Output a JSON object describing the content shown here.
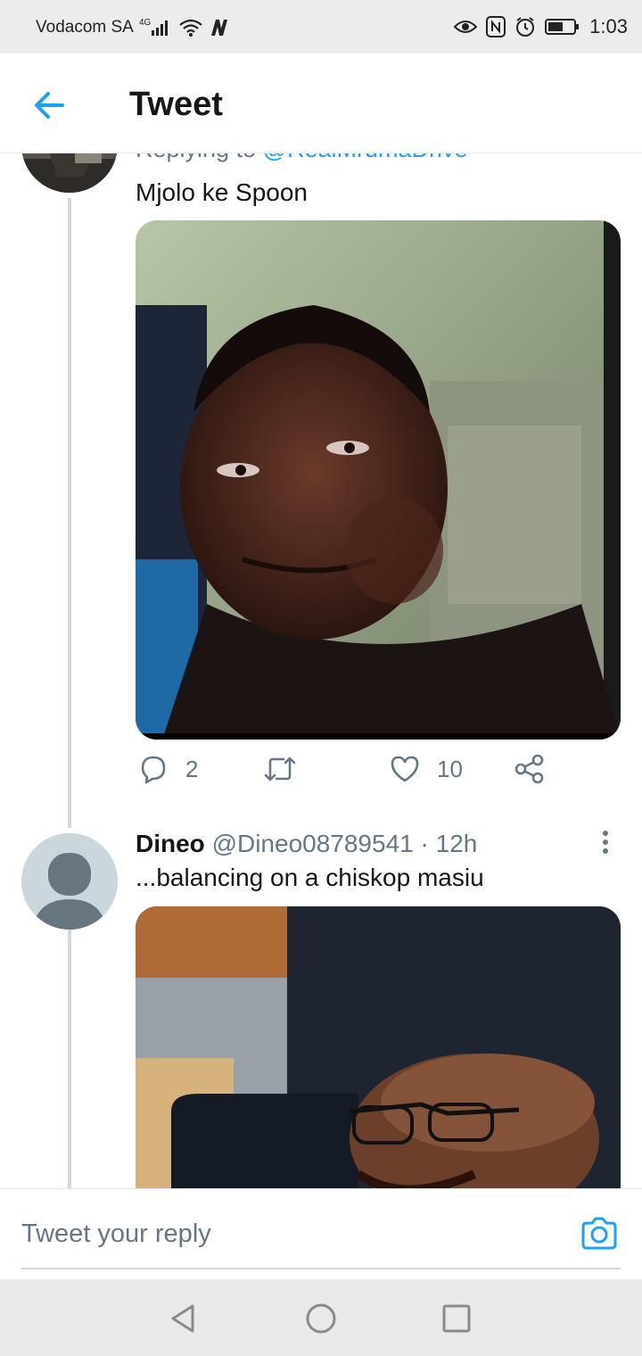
{
  "status_bar": {
    "carrier": "Vodacom SA",
    "network": "4G",
    "time": "1:03",
    "icons": [
      "signal-icon",
      "wifi-icon",
      "n-app-icon",
      "eye-comfort-icon",
      "nfc-icon",
      "alarm-icon",
      "battery-icon"
    ]
  },
  "header": {
    "title": "Tweet",
    "back_icon": "back-arrow-icon"
  },
  "thread": {
    "tweet1": {
      "replying_to_label": "Replying to",
      "replying_to_handle": "@RealMrumaDrive",
      "text": "Mjolo ke Spoon",
      "reply_count": "2",
      "retweet_count": "",
      "like_count": "10"
    },
    "tweet2": {
      "name": "Dineo",
      "handle": "@Dineo08789541",
      "separator": "·",
      "time": "12h",
      "text": "...balancing on a chiskop masiu"
    }
  },
  "reply_bar": {
    "placeholder": "Tweet your reply",
    "camera_icon": "camera-icon"
  },
  "nav_bar": {
    "icons": [
      "nav-back-icon",
      "nav-home-icon",
      "nav-recents-icon"
    ]
  },
  "colors": {
    "accent": "#1da1f2",
    "text": "#14171a",
    "secondary": "#657786"
  }
}
